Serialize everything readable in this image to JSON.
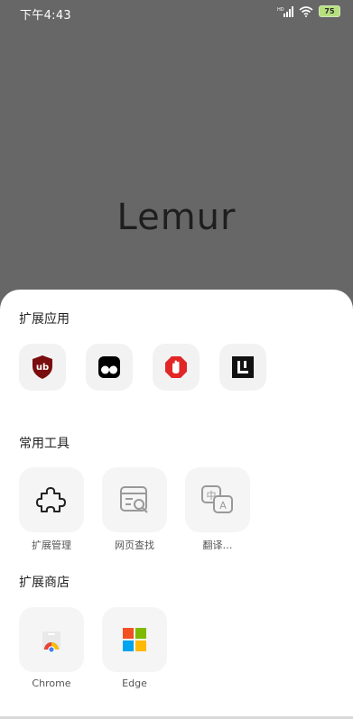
{
  "status_bar": {
    "time": "下午4:43",
    "battery": "75",
    "battery_color": "#b7e07f"
  },
  "brand": {
    "name": "Lemur"
  },
  "sections": {
    "extensions": {
      "title": "扩展应用",
      "items": [
        {
          "icon": "ublock-origin-icon",
          "color": "#7a0d0d"
        },
        {
          "icon": "tampermonkey-icon",
          "color": "#000000"
        },
        {
          "icon": "adblock-icon",
          "color": "#e22626"
        },
        {
          "icon": "lemur-extension-icon",
          "color": "#111111"
        }
      ]
    },
    "tools": {
      "title": "常用工具",
      "items": [
        {
          "label": "扩展管理",
          "icon": "puzzle-icon"
        },
        {
          "label": "网页查找",
          "icon": "web-search-icon"
        },
        {
          "label": "翻译…",
          "icon": "translate-icon"
        }
      ]
    },
    "store": {
      "title": "扩展商店",
      "items": [
        {
          "label": "Chrome",
          "icon": "chrome-store-icon"
        },
        {
          "label": "Edge",
          "icon": "edge-store-icon"
        }
      ]
    }
  }
}
